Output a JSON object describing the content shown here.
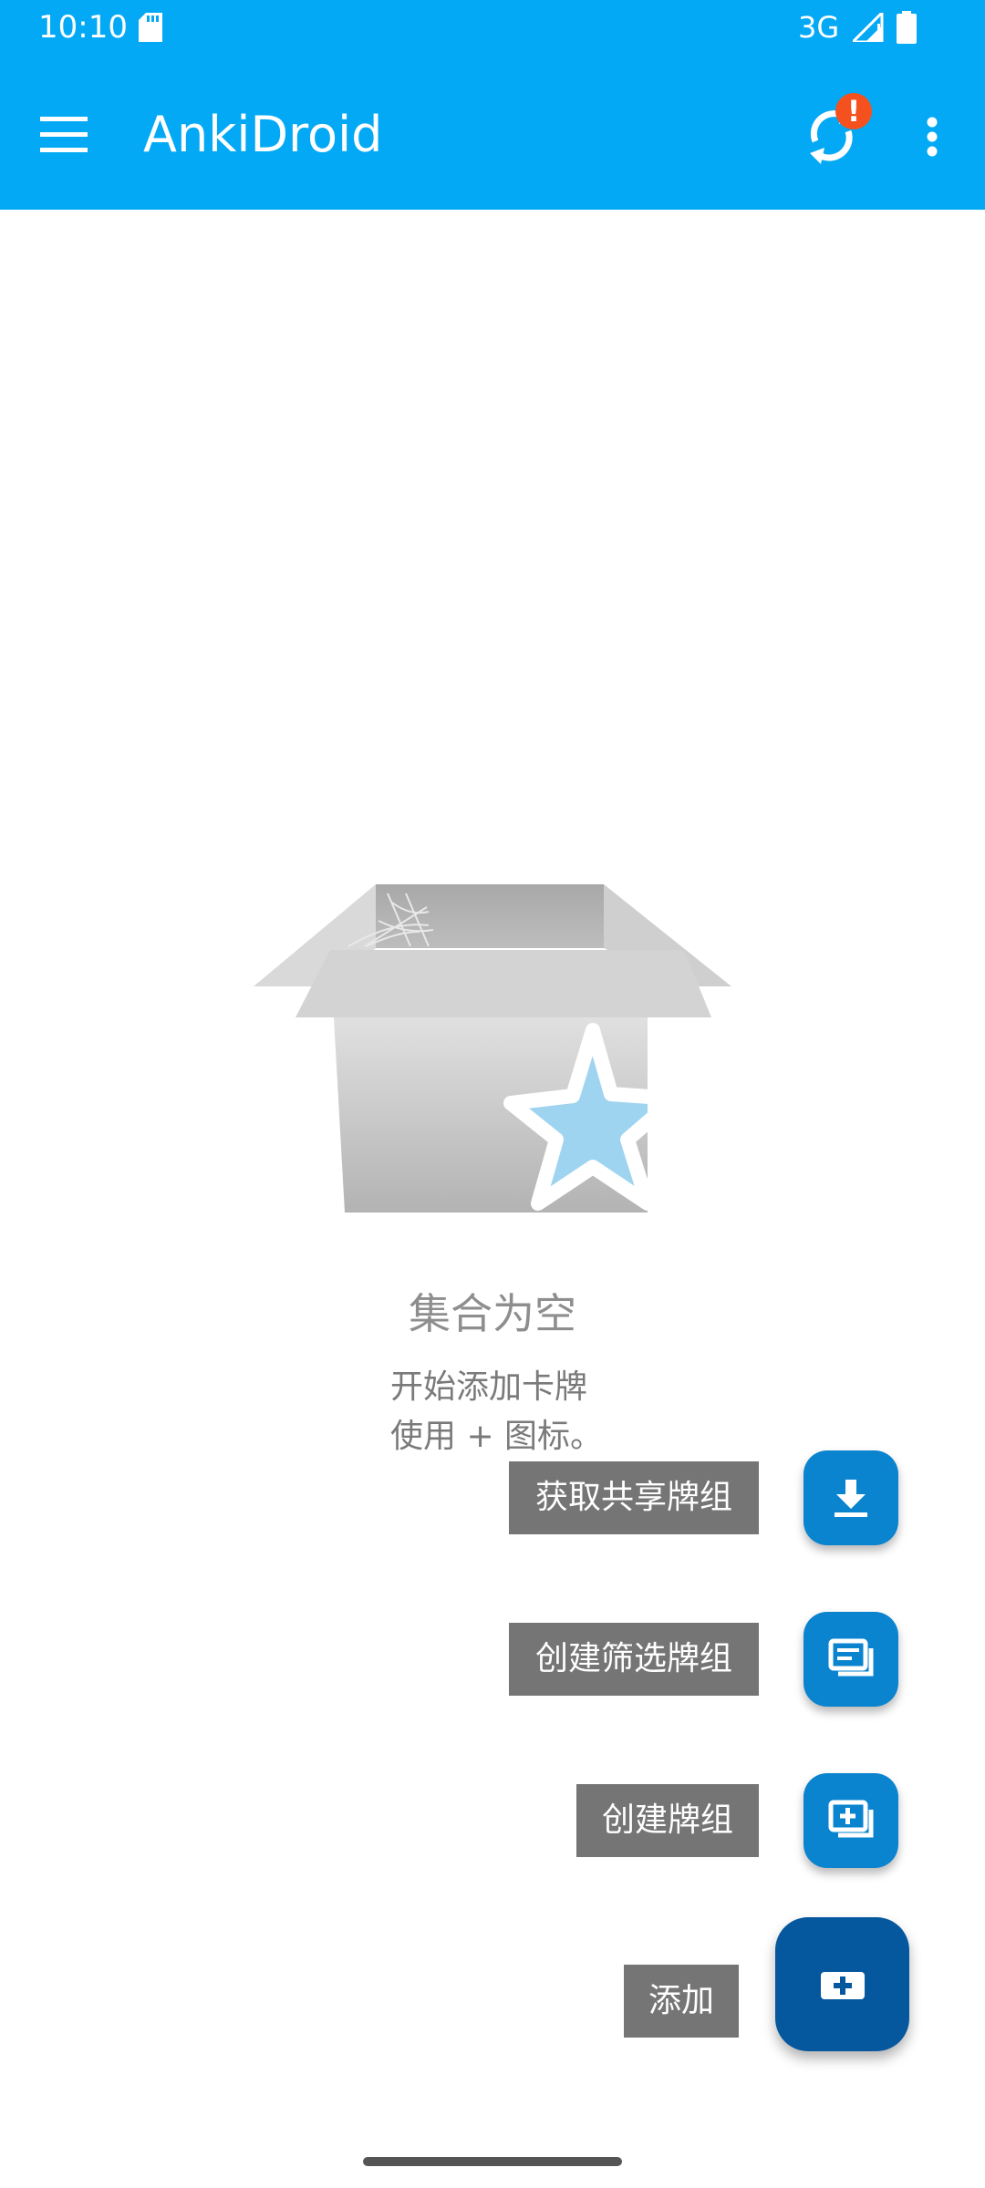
{
  "status_bar": {
    "time": "10:10",
    "network": "3G",
    "icons": [
      "sd-card-icon",
      "signal-icon",
      "battery-icon"
    ]
  },
  "app_bar": {
    "title": "AnkiDroid",
    "background": "#03A9F4",
    "sync_alert_badge": "!",
    "icons": [
      "menu-icon",
      "sync-icon",
      "more-vert-icon"
    ]
  },
  "empty_state": {
    "title": "集合为空",
    "line1": "开始添加卡牌",
    "line2": "使用 + 图标。"
  },
  "fab_menu": {
    "items": [
      {
        "label": "获取共享牌组",
        "icon": "download-icon"
      },
      {
        "label": "创建筛选牌组",
        "icon": "filtered-deck-icon"
      },
      {
        "label": "创建牌组",
        "icon": "add-deck-icon"
      },
      {
        "label": "添加",
        "icon": "add-card-icon"
      }
    ],
    "mini_fab_color": "#0A84CF",
    "main_fab_color": "#05579E",
    "label_color": "#757575"
  }
}
